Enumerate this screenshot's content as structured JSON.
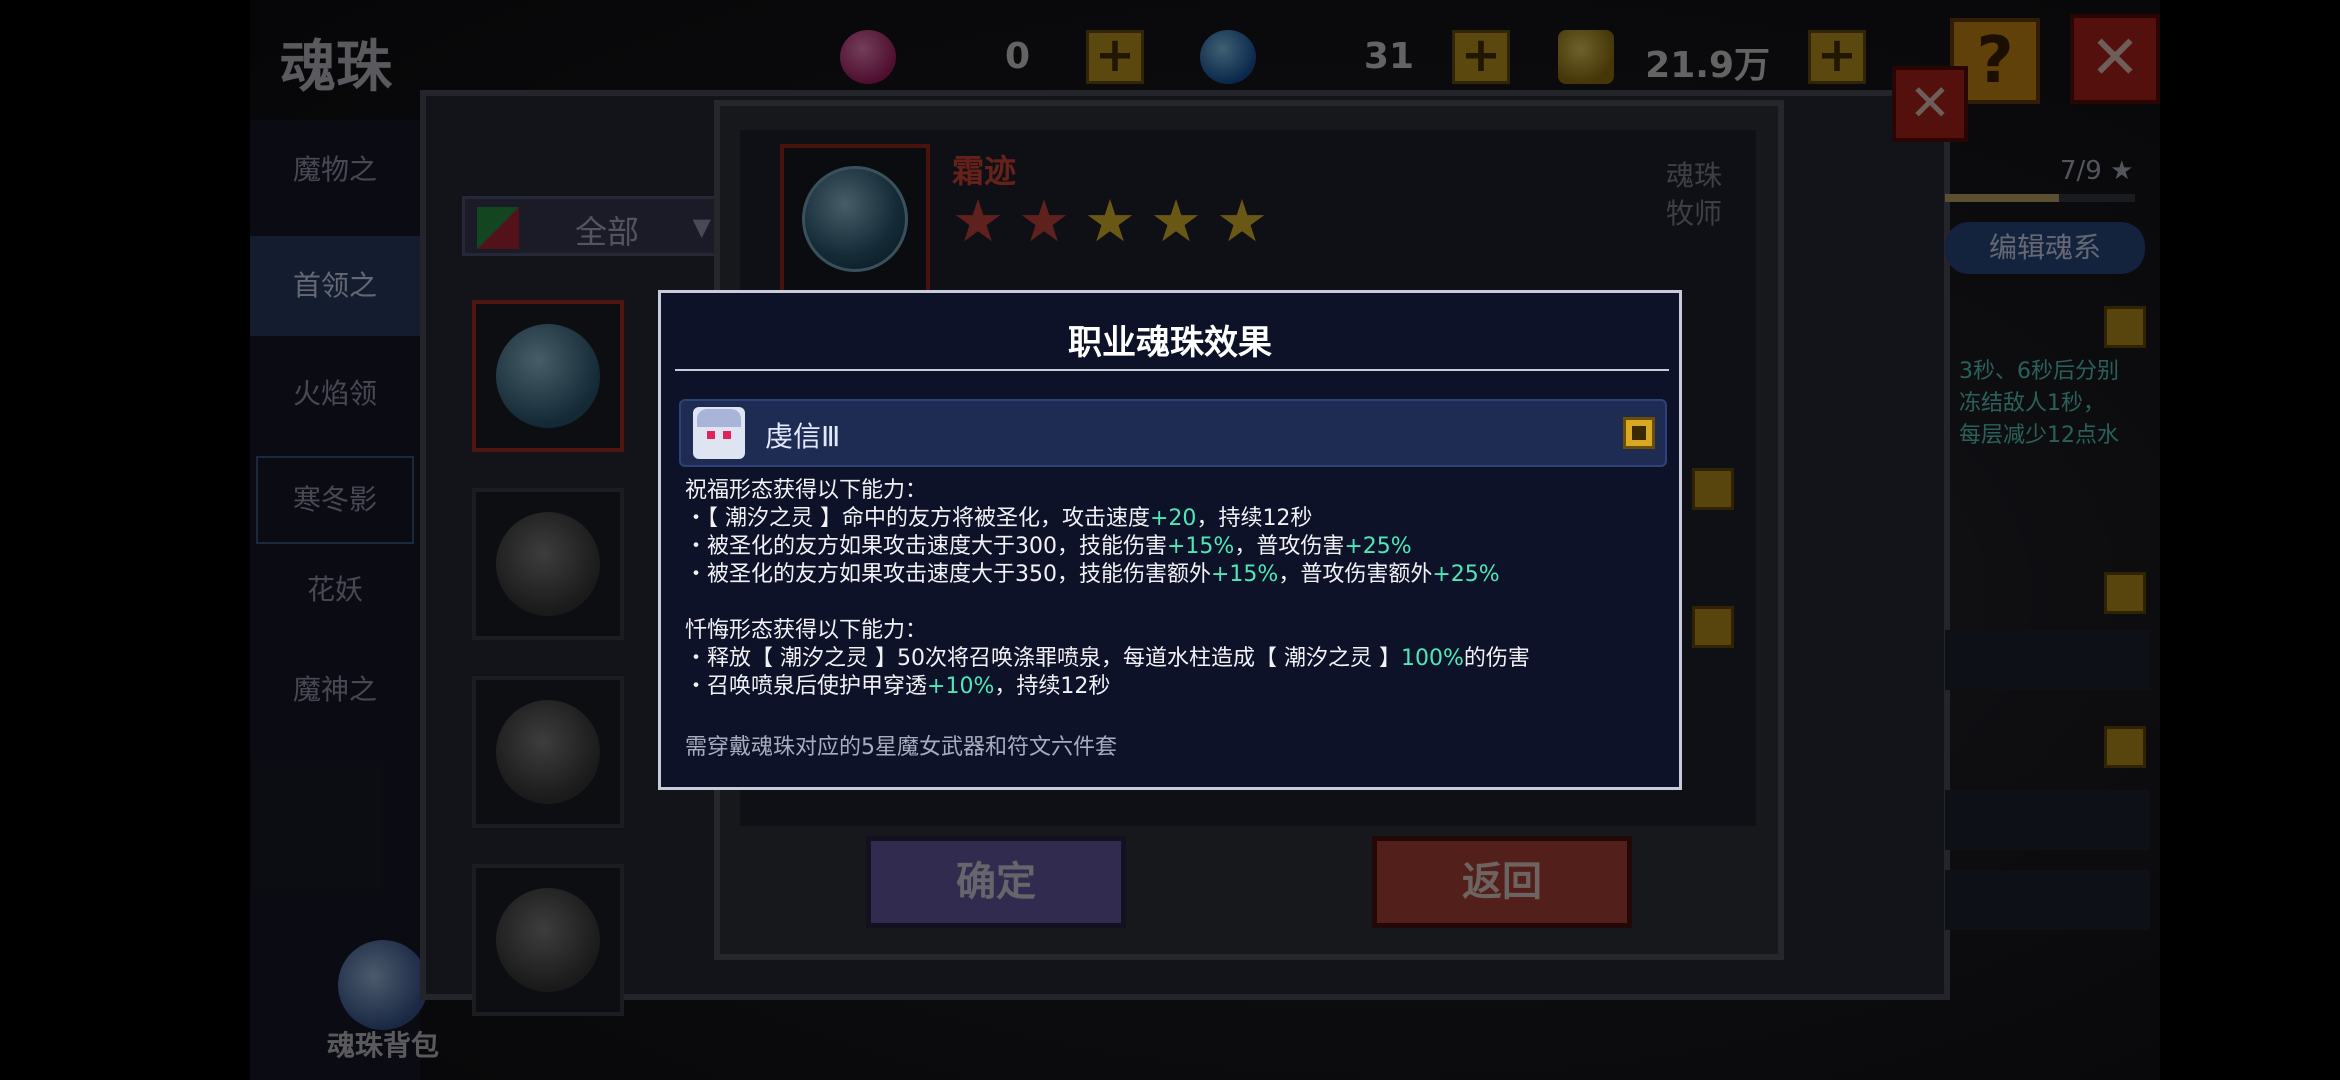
{
  "app": {
    "title": "魂珠",
    "close_label": "✕",
    "help_label": "?"
  },
  "currencies": [
    {
      "name": "pink-gem",
      "value": "0",
      "color": "#d43c8a"
    },
    {
      "name": "blue-gem",
      "value": "31",
      "color": "#2e88d8"
    },
    {
      "name": "gold-coin",
      "value": "21.9万",
      "color": "#c9a020"
    }
  ],
  "plus_label": "+",
  "left_tabs": [
    {
      "label": "魔物之"
    },
    {
      "label": "首领之"
    },
    {
      "label": "火焰领"
    },
    {
      "label": "寒冬影"
    },
    {
      "label": "花妖"
    },
    {
      "label": "魔神之"
    }
  ],
  "filter": {
    "label": "全部",
    "arrow": "▼"
  },
  "bag": {
    "label": "魂珠背包"
  },
  "detail": {
    "name": "霜迹",
    "type": "魂珠",
    "class": "牧师",
    "stars": [
      "★",
      "★",
      "★",
      "★",
      "★"
    ],
    "star_colors": [
      "red",
      "red",
      "gold",
      "gold",
      "gold"
    ],
    "sub_close_label": "✕",
    "confirm_label": "确定",
    "back_label": "返回"
  },
  "right_panel": {
    "progress": "7/9 ★",
    "edit_label": "编辑魂系",
    "text_lines": [
      "3秒、6秒后分别",
      "冻结敌人1秒，",
      "每层减少12点水"
    ]
  },
  "modal": {
    "title": "职业魂珠效果",
    "header_name": "虔信Ⅲ",
    "section1_title": "祝福形态获得以下能力：",
    "section1_lines": [
      [
        {
          "t": "・【 潮汐之灵 】命中的友方将被圣化，攻击速度"
        },
        {
          "t": "+20",
          "hl": true
        },
        {
          "t": "，持续12秒"
        }
      ],
      [
        {
          "t": "・被圣化的友方如果攻击速度大于300，技能伤害"
        },
        {
          "t": "+15%",
          "hl": true
        },
        {
          "t": "，普攻伤害"
        },
        {
          "t": "+25%",
          "hl": true
        }
      ],
      [
        {
          "t": "・被圣化的友方如果攻击速度大于350，技能伤害额外"
        },
        {
          "t": "+15%",
          "hl": true
        },
        {
          "t": "，普攻伤害额外"
        },
        {
          "t": "+25%",
          "hl": true
        }
      ]
    ],
    "section2_title": "忏悔形态获得以下能力：",
    "section2_lines": [
      [
        {
          "t": "・释放【 潮汐之灵 】50次将召唤涤罪喷泉，每道水柱造成【 潮汐之灵 】"
        },
        {
          "t": "100%",
          "hl": true
        },
        {
          "t": "的伤害"
        }
      ],
      [
        {
          "t": "・召唤喷泉后使护甲穿透"
        },
        {
          "t": "+10%",
          "hl": true
        },
        {
          "t": "，持续12秒"
        }
      ]
    ],
    "footer": "需穿戴魂珠对应的5星魔女武器和符文六件套"
  }
}
